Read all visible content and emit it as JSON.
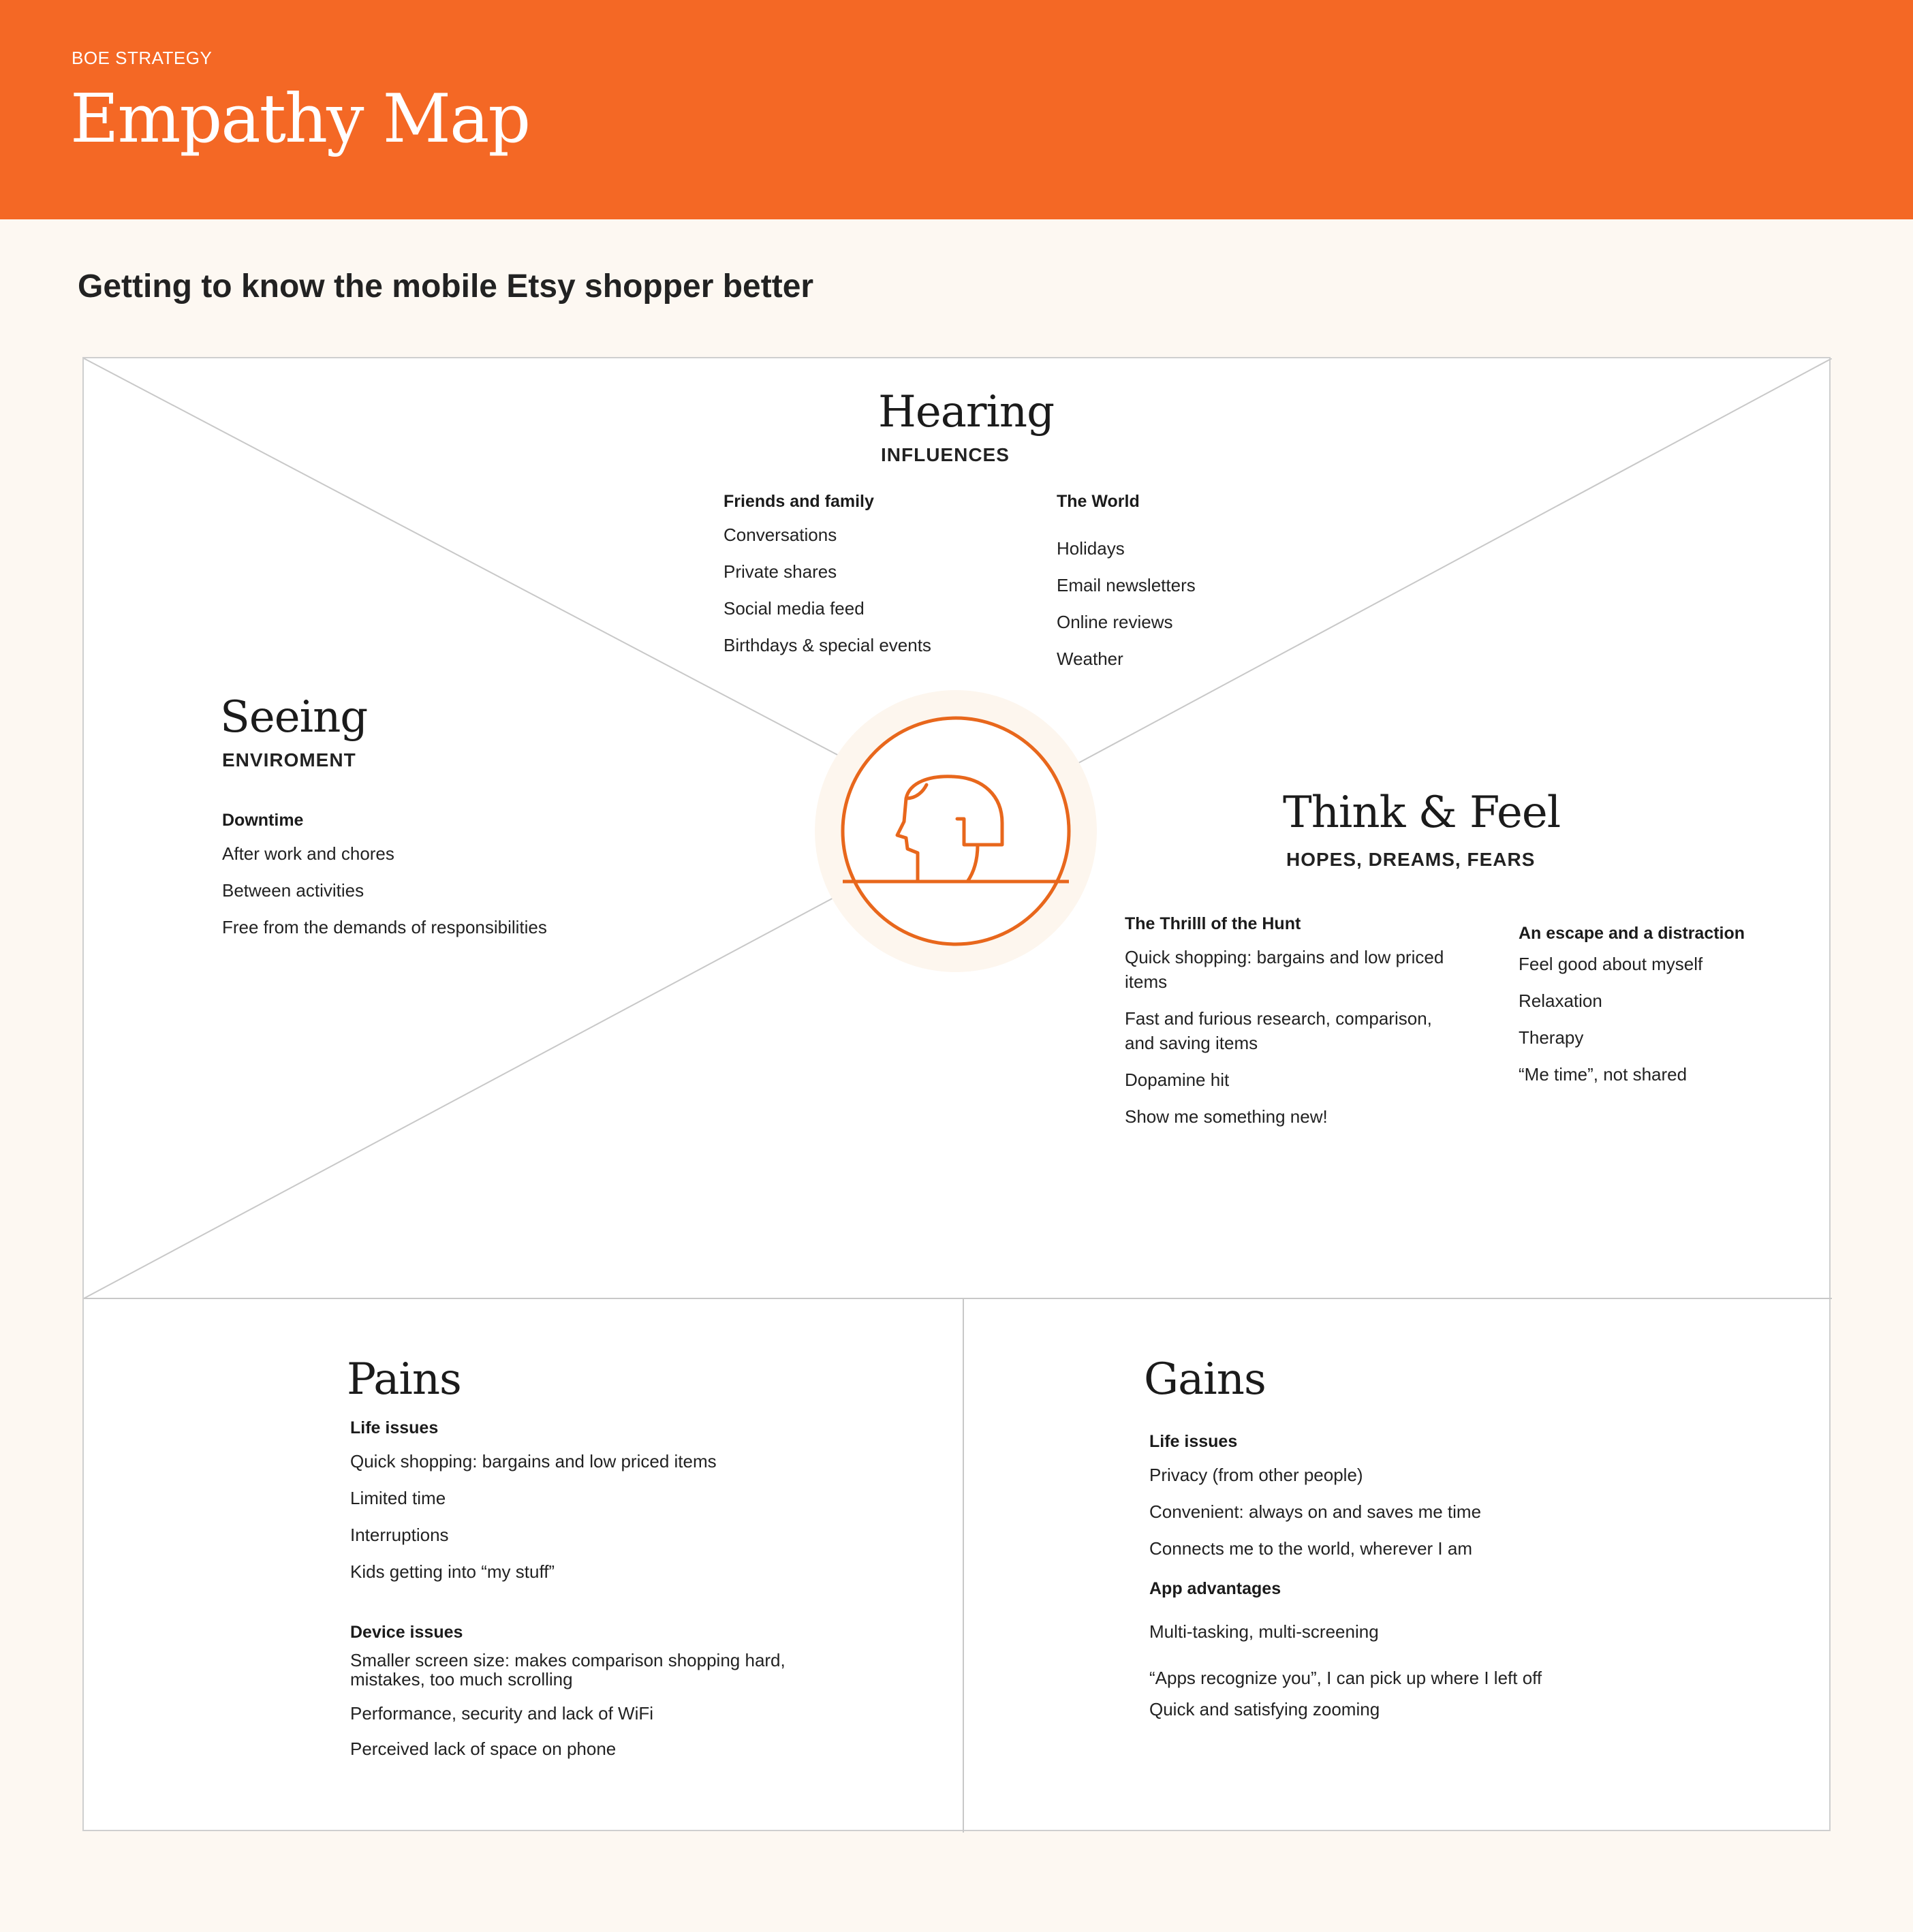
{
  "header": {
    "kicker": "BOE STRATEGY",
    "title": "Empathy Map",
    "background_color": "#f46825"
  },
  "subtitle": "Getting to know the mobile Etsy shopper better",
  "accent_color": "#e8671c",
  "hearing": {
    "title": "Hearing",
    "subtitle": "INFLUENCES",
    "groups": [
      {
        "heading": "Friends and family",
        "items": [
          "Conversations",
          "Private shares",
          "Social media feed",
          "Birthdays & special events"
        ]
      },
      {
        "heading": "The World",
        "items": [
          "Holidays",
          "Email newsletters",
          "Online reviews",
          "Weather"
        ]
      }
    ]
  },
  "seeing": {
    "title": "Seeing",
    "subtitle": "ENVIROMENT",
    "groups": [
      {
        "heading": "Downtime",
        "items": [
          "After work and chores",
          "Between activities",
          "Free from the demands of responsibilities"
        ]
      }
    ]
  },
  "think_feel": {
    "title": "Think & Feel",
    "subtitle": "HOPES, DREAMS, FEARS",
    "groups": [
      {
        "heading": "The Thrilll of the Hunt",
        "items": [
          "Quick shopping: bargains and low priced items",
          "Fast and furious research, comparison, and saving items",
          "Dopamine hit",
          "Show me something new!"
        ]
      },
      {
        "heading": "An escape and a distraction",
        "items": [
          "Feel good about myself",
          "Relaxation",
          "Therapy",
          "“Me time”, not shared"
        ]
      }
    ]
  },
  "pains": {
    "title": "Pains",
    "groups": [
      {
        "heading": "Life issues",
        "items": [
          "Quick shopping: bargains and low priced items",
          "Limited time",
          "Interruptions",
          "Kids getting into “my stuff”"
        ]
      },
      {
        "heading": "Device issues",
        "items": [
          "Smaller screen size: makes comparison shopping hard, mistakes, too much scrolling",
          "Performance, security and lack of WiFi",
          "Perceived lack of space on phone"
        ]
      }
    ]
  },
  "gains": {
    "title": "Gains",
    "groups": [
      {
        "heading": "Life issues",
        "items": [
          "Privacy (from other people)",
          "Convenient: always on and saves me time",
          "Connects me to the world, wherever I am"
        ]
      },
      {
        "heading": "App advantages",
        "items": [
          "Multi-tasking, multi-screening",
          "“Apps recognize you”, I can pick up where I left off",
          "Quick and satisfying zooming"
        ]
      }
    ]
  },
  "center_icon": "person-head-icon"
}
